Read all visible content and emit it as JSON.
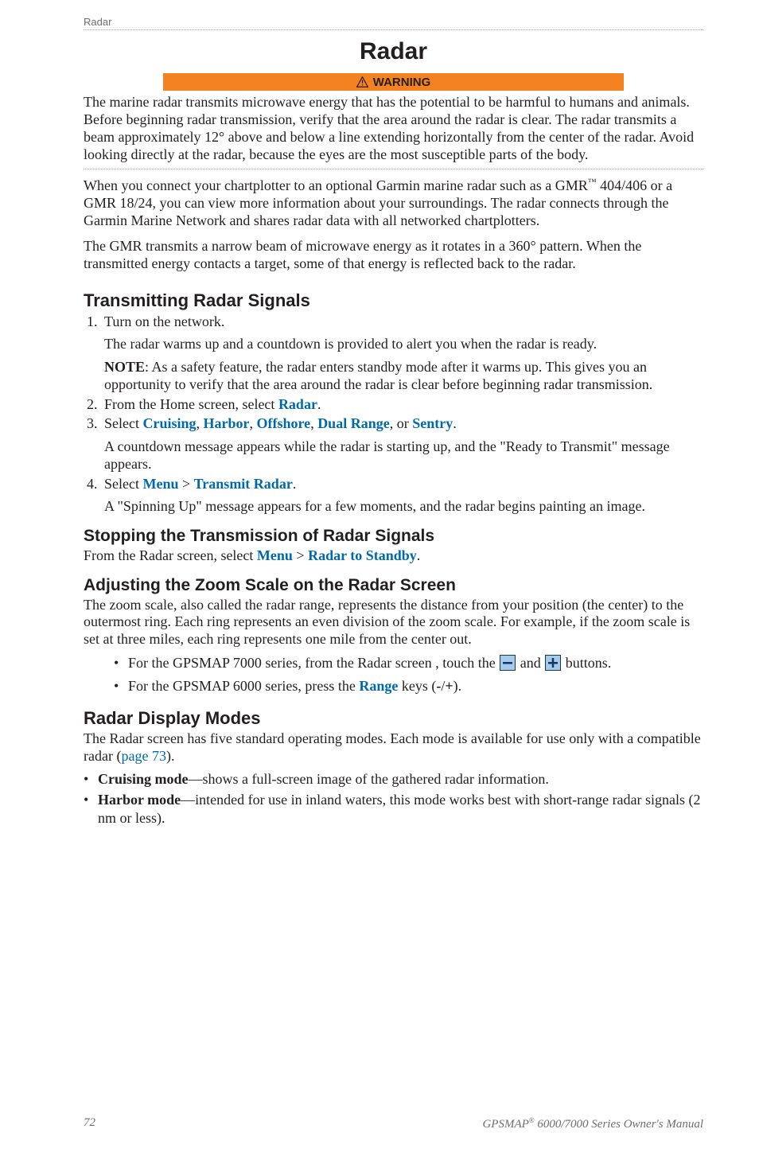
{
  "runningHead": "Radar",
  "title": "Radar",
  "warningLabel": "WARNING",
  "warningText": "The marine radar transmits microwave energy that has the potential to be harmful to humans and animals. Before beginning radar transmission, verify that the area around the radar is clear. The radar transmits a beam approximately 12° above and below a line extending horizontally from the center of the radar. Avoid looking directly at the radar, because the eyes are the most susceptible parts of the body.",
  "intro1_a": "When you connect your chartplotter to an optional Garmin marine radar such as a GMR",
  "intro1_tm": "™",
  "intro1_b": " 404/406 or a GMR 18/24, you can view more information about your surroundings. The radar connects through the Garmin Marine Network and shares radar data with all networked chartplotters.",
  "intro2": "The GMR transmits a narrow beam of microwave energy as it rotates in a 360° pattern. When the transmitted energy contacts a target, some of that energy is reflected back to the radar.",
  "sec_transmitting": "Transmitting Radar Signals",
  "step1": "Turn on the network.",
  "step1_p1": "The radar warms up and a countdown is provided to alert you when the radar is ready.",
  "step1_noteLabel": "NOTE",
  "step1_noteText": ": As a safety feature, the radar enters standby mode after it warms up. This gives you an opportunity to verify that the area around the radar is clear before beginning radar transmission.",
  "step2_a": "From the Home screen, select ",
  "step2_ui": "Radar",
  "step2_b": ".",
  "step3_a": "Select ",
  "step3_opt1": "Cruising",
  "step3_opt2": "Harbor",
  "step3_opt3": "Offshore",
  "step3_opt4": "Dual Range",
  "step3_opt5": "Sentry",
  "step3_sep": ", ",
  "step3_or": ", or ",
  "step3_end": ".",
  "step3_p": "A countdown message appears while the radar is starting up, and the \"Ready to Transmit\" message appears.",
  "step4_a": "Select ",
  "step4_ui1": "Menu",
  "step4_gt": " > ",
  "step4_ui2": "Transmit Radar",
  "step4_b": ".",
  "step4_p": "A \"Spinning Up\" message appears for a few moments, and the radar begins painting an image.",
  "sec_stopping": "Stopping the Transmission of Radar Signals",
  "stop_a": "From the Radar screen, select ",
  "stop_ui1": "Menu",
  "stop_gt": " > ",
  "stop_ui2": "Radar to Standby",
  "stop_b": ".",
  "sec_zoom": "Adjusting the Zoom Scale on the Radar Screen",
  "zoom_intro": "The zoom scale, also called the radar range, represents the distance from your position (the center) to the outermost ring. Each ring represents an even division of the zoom scale. For example, if the zoom scale is set at three miles, each ring represents one mile from the center out.",
  "zoom_b1_a": "For the GPSMAP 7000 series, from the Radar screen , touch the ",
  "zoom_b1_mid": " and ",
  "zoom_b1_b": " buttons.",
  "zoom_b2_a": "For the GPSMAP 6000 series, press the ",
  "zoom_b2_ui": "Range",
  "zoom_b2_b": " keys (",
  "zoom_b2_minus": "-",
  "zoom_b2_slash": "/",
  "zoom_b2_plus": "+",
  "zoom_b2_c": ").",
  "sec_modes": "Radar Display Modes",
  "modes_intro_a": "The Radar screen has five standard operating modes. Each mode is available for use only with a compatible radar (",
  "modes_link": "page 73",
  "modes_intro_b": ").",
  "mode1_label": "Cruising mode",
  "mode1_text": "—shows a full-screen image of the gathered radar information.",
  "mode2_label": "Harbor mode",
  "mode2_text": "—intended for use in inland waters, this mode works best with short-range radar signals (2 nm or less).",
  "footerPage": "72",
  "footerText_a": "GPSMAP",
  "footerText_reg": "®",
  "footerText_b": " 6000/7000 Series Owner's Manual"
}
